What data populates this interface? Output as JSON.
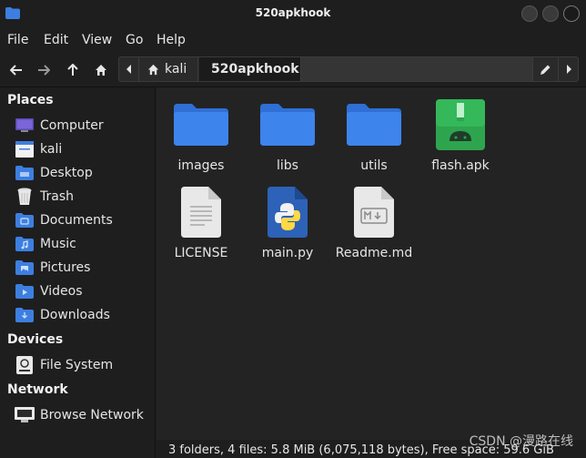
{
  "window": {
    "title": "520apkhook"
  },
  "menu": [
    "File",
    "Edit",
    "View",
    "Go",
    "Help"
  ],
  "toolbar": {
    "back_icon": "back-arrow-icon",
    "forward_icon": "forward-arrow-icon",
    "up_icon": "up-arrow-icon",
    "home_icon": "home-icon"
  },
  "path": {
    "home_label": "kali",
    "current_label": "520apkhook"
  },
  "sidebar": {
    "places_title": "Places",
    "places": [
      {
        "label": "Computer",
        "icon": "computer-icon"
      },
      {
        "label": "kali",
        "icon": "home-folder-icon"
      },
      {
        "label": "Desktop",
        "icon": "desktop-icon"
      },
      {
        "label": "Trash",
        "icon": "trash-icon"
      },
      {
        "label": "Documents",
        "icon": "documents-icon"
      },
      {
        "label": "Music",
        "icon": "music-icon"
      },
      {
        "label": "Pictures",
        "icon": "pictures-icon"
      },
      {
        "label": "Videos",
        "icon": "videos-icon"
      },
      {
        "label": "Downloads",
        "icon": "downloads-icon"
      }
    ],
    "devices_title": "Devices",
    "devices": [
      {
        "label": "File System",
        "icon": "drive-icon"
      }
    ],
    "network_title": "Network",
    "network": [
      {
        "label": "Browse Network",
        "icon": "network-icon"
      }
    ]
  },
  "files": [
    {
      "name": "images",
      "type": "folder"
    },
    {
      "name": "libs",
      "type": "folder"
    },
    {
      "name": "utils",
      "type": "folder"
    },
    {
      "name": "flash.apk",
      "type": "apk"
    },
    {
      "name": "LICENSE",
      "type": "text"
    },
    {
      "name": "main.py",
      "type": "python"
    },
    {
      "name": "Readme.md",
      "type": "markdown"
    }
  ],
  "status": {
    "text": "3 folders, 4 files: 5.8 MiB (6,075,118 bytes), Free space: 59.6 GiB"
  },
  "watermark": "CSDN @漫路在线",
  "colors": {
    "folder": "#3d7fe0",
    "apk": "#2ea44f",
    "python": "#3a6bc5",
    "page": "#e8e8e8"
  }
}
